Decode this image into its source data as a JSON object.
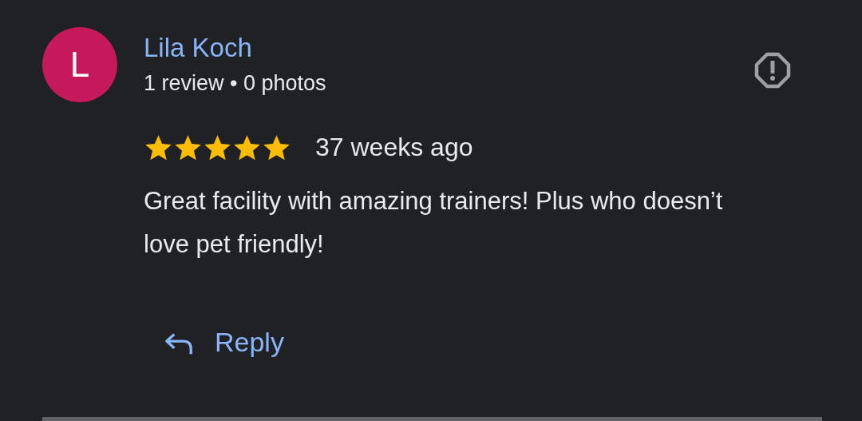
{
  "review": {
    "avatar_letter": "L",
    "author": "Lila Koch",
    "author_meta": "1 review • 0 photos",
    "stars": 5,
    "time": "37 weeks ago",
    "text": "Great facility with amazing trainers! Plus who doesn’t love pet friendly!",
    "reply_label": "Reply"
  }
}
